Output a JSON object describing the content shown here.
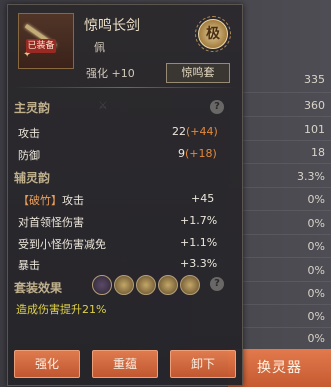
{
  "item": {
    "name": "惊鸣长剑",
    "equipped_badge": "已装备",
    "slot": "佩",
    "enhance": "强化 +10",
    "rarity": "极",
    "set_name": "惊鸣套"
  },
  "sections": {
    "main": "主灵韵",
    "sub": "辅灵韵",
    "set_effects": "套装效果"
  },
  "main_stats": [
    {
      "label": "攻击",
      "base": "22",
      "bonus": "(+44)"
    },
    {
      "label": "防御",
      "base": "9",
      "bonus": "(+18)"
    }
  ],
  "sub_stats": [
    {
      "tag": "【破竹】",
      "label": "攻击",
      "value": "+45"
    },
    {
      "tag": "",
      "label": "对首领怪伤害",
      "value": "+1.7%"
    },
    {
      "tag": "",
      "label": "受到小怪伤害减免",
      "value": "+1.1%"
    },
    {
      "tag": "",
      "label": "暴击",
      "value": "+3.3%"
    }
  ],
  "set_bonus_text": "造成伤害提升21%",
  "buttons": {
    "enhance": "强化",
    "reforge": "重蕴",
    "unequip": "卸下",
    "swap": "换灵器"
  },
  "background_values": [
    "335",
    "360",
    "101",
    "18",
    "3.3%",
    "0%",
    "0%",
    "0%",
    "0%",
    "0%",
    "0%",
    "0%"
  ],
  "colors": {
    "bonus": "#e98c3a",
    "set_bonus": "#e4d64a",
    "button": "#d8683c"
  }
}
